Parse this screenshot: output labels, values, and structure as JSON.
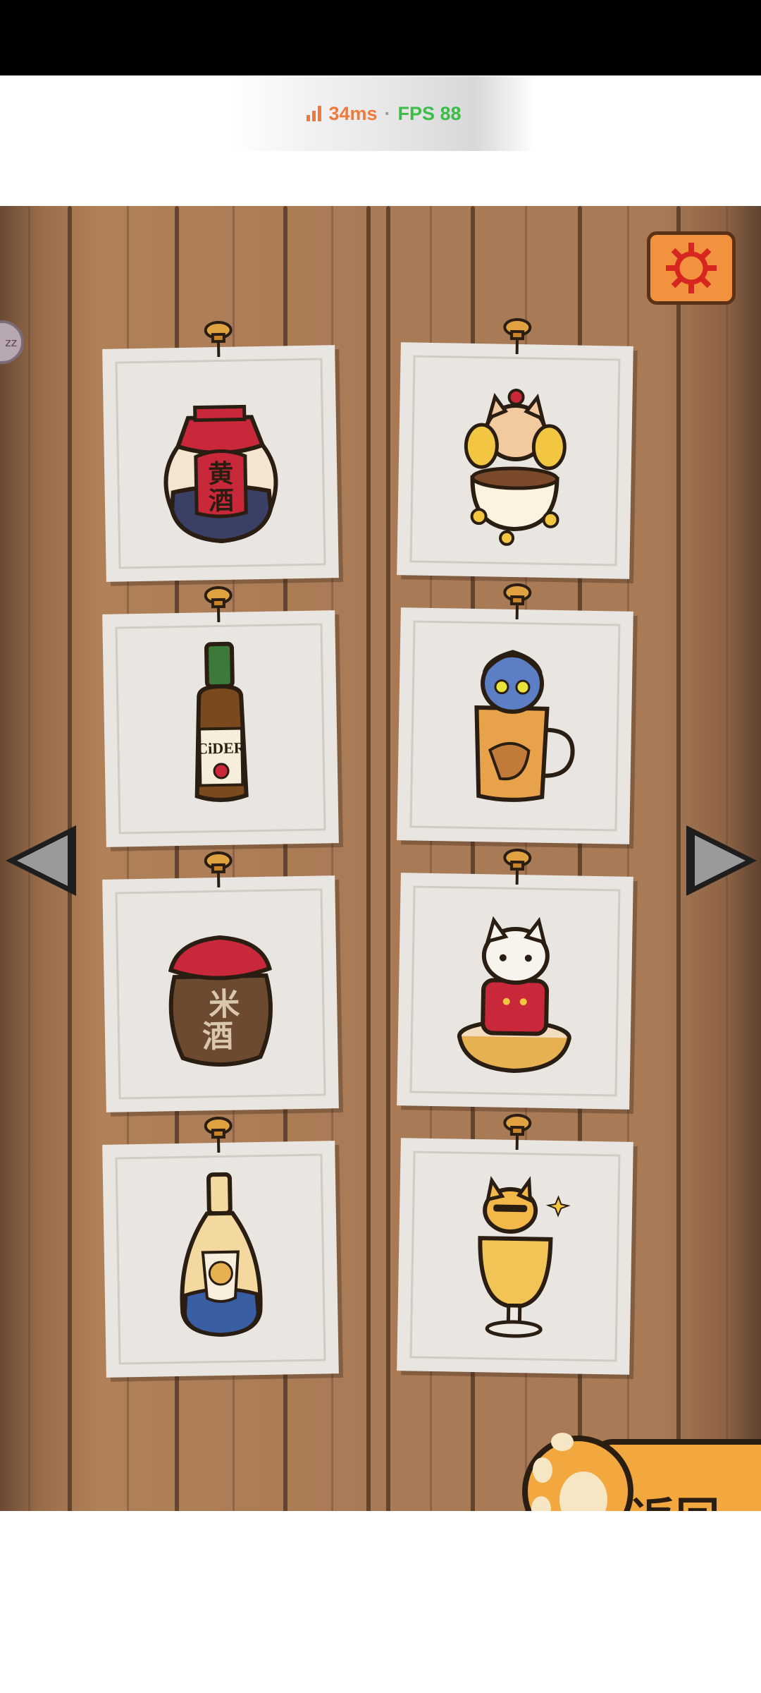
{
  "perf": {
    "latency": "34ms",
    "separator": "·",
    "fps": "FPS 88"
  },
  "side_bubble": {
    "text": "zz"
  },
  "cards": [
    {
      "name": "huangjiu-jar",
      "text": "黄酒"
    },
    {
      "name": "cat-in-teacup",
      "text": ""
    },
    {
      "name": "cider-bottle",
      "text": "CiDER"
    },
    {
      "name": "blue-cat-apple-mug",
      "text": ""
    },
    {
      "name": "rice-wine-jar",
      "text": "米酒"
    },
    {
      "name": "cat-in-bowl",
      "text": ""
    },
    {
      "name": "blue-label-bottle",
      "text": ""
    },
    {
      "name": "cat-in-beer-glass",
      "text": ""
    }
  ],
  "back_button": {
    "label": "返回"
  },
  "icons": {
    "settings": "gear-icon",
    "prev": "arrow-left-icon",
    "next": "arrow-right-icon",
    "back": "paw-icon"
  },
  "colors": {
    "accent": "#f2923e",
    "wood": "#a87a55",
    "card": "#e9e6e1",
    "red": "#c8283a",
    "outline": "#2a1d12"
  }
}
